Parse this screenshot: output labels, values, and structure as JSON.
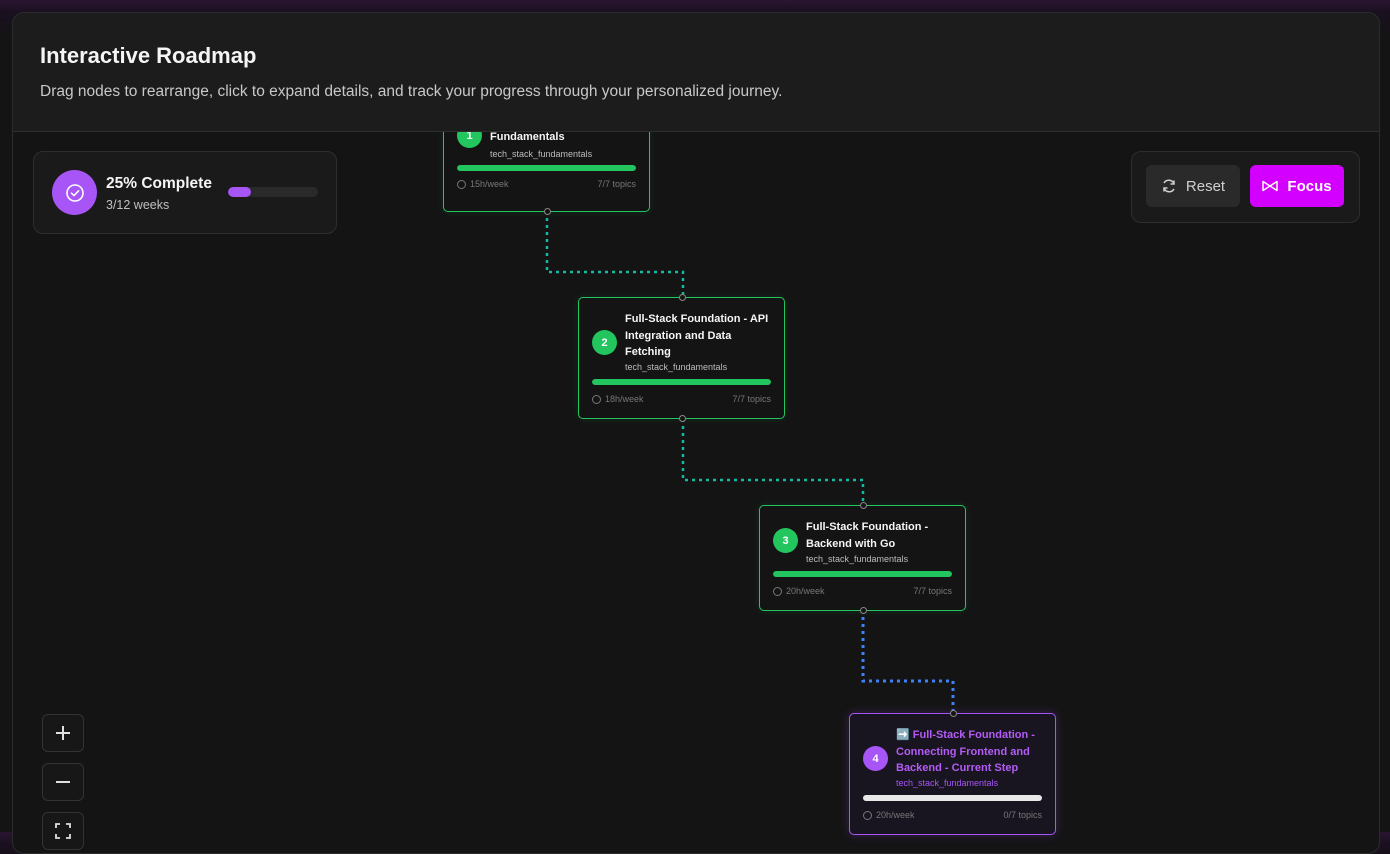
{
  "header": {
    "title": "Interactive Roadmap",
    "subtitle": "Drag nodes to rearrange, click to expand details, and track your progress through your personalized journey."
  },
  "progress": {
    "title": "25% Complete",
    "weeks": "3/12 weeks",
    "percent": 25
  },
  "controls": {
    "reset_label": "Reset",
    "focus_label": "Focus"
  },
  "nodes": [
    {
      "step": "1",
      "title": "Fundamentals",
      "category": "tech_stack_fundamentals",
      "hours": "15h/week",
      "topics": "7/7 topics",
      "progress": 100,
      "status": "completed"
    },
    {
      "step": "2",
      "title": "Full-Stack Foundation - API Integration and Data Fetching",
      "category": "tech_stack_fundamentals",
      "hours": "18h/week",
      "topics": "7/7 topics",
      "progress": 100,
      "status": "completed"
    },
    {
      "step": "3",
      "title": "Full-Stack Foundation - Backend with Go",
      "category": "tech_stack_fundamentals",
      "hours": "20h/week",
      "topics": "7/7 topics",
      "progress": 100,
      "status": "completed"
    },
    {
      "step": "4",
      "title": "➡️ Full-Stack Foundation - Connecting Frontend and Backend - Current Step",
      "category": "tech_stack_fundamentals",
      "hours": "20h/week",
      "topics": "0/7 topics",
      "progress": 0,
      "status": "current"
    }
  ],
  "colors": {
    "completed": "#22c55e",
    "current": "#a855f7",
    "edge_done": "#14b8a6",
    "edge_current": "#3b82f6",
    "focus_button": "#d400ff"
  },
  "icons": {
    "progress": "check-circle-icon",
    "reset": "refresh-icon",
    "focus": "bowtie-icon",
    "zoom_in": "plus-icon",
    "zoom_out": "minus-icon",
    "fit": "fit-view-icon",
    "clock": "clock-icon"
  }
}
